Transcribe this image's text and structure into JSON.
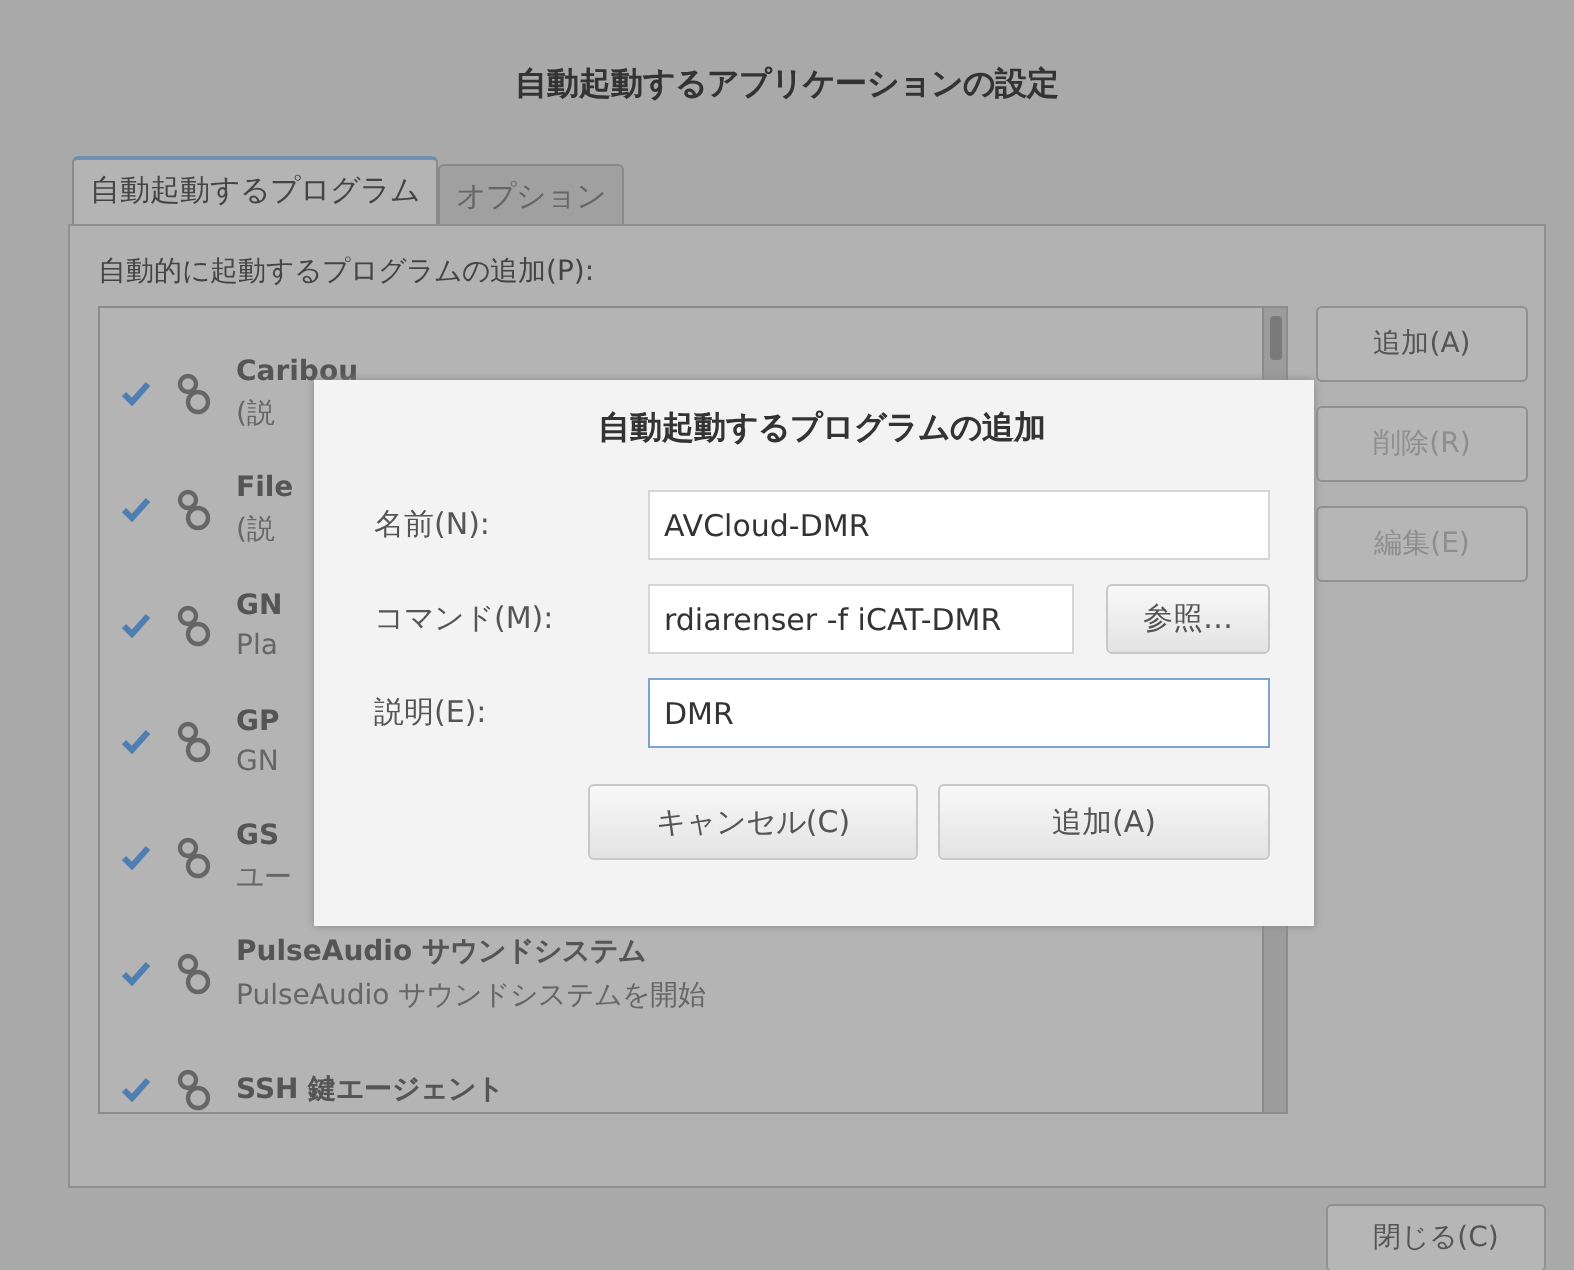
{
  "window": {
    "title": "自動起動するアプリケーションの設定"
  },
  "tabs": [
    {
      "label": "自動起動するプログラム",
      "selected": true
    },
    {
      "label": "オプション",
      "selected": false
    }
  ],
  "list_label": "自動的に起動するプログラムの追加(P):",
  "programs": [
    {
      "name": "Caribou",
      "description": "(説",
      "checked": true
    },
    {
      "name": "File",
      "description": "(説",
      "checked": true
    },
    {
      "name": "GN",
      "description": "Pla",
      "checked": true
    },
    {
      "name": "GP",
      "description": "GN",
      "checked": true
    },
    {
      "name": "GS",
      "description": "ユー",
      "checked": true
    },
    {
      "name": "PulseAudio サウンドシステム",
      "description": "PulseAudio サウンドシステムを開始",
      "checked": true
    },
    {
      "name": "SSH 鍵エージェント",
      "checked": true
    }
  ],
  "side_buttons": [
    {
      "label": "追加(A)",
      "disabled": false
    },
    {
      "label": "削除(R)",
      "disabled": true
    },
    {
      "label": "編集(E)",
      "disabled": true
    }
  ],
  "close_button": "閉じる(C)",
  "dialog": {
    "title": "自動起動するプログラムの追加",
    "fields": [
      {
        "label": "名前(N):",
        "value": "AVCloud-DMR",
        "focused": false
      },
      {
        "label": "コマンド(M):",
        "value": "rdiarenser -f iCAT-DMR",
        "focused": false,
        "browse": "参照…"
      },
      {
        "label": "説明(E):",
        "value": "DMR",
        "focused": true
      }
    ],
    "buttons": [
      "キャンセル(C)",
      "追加(A)"
    ]
  }
}
